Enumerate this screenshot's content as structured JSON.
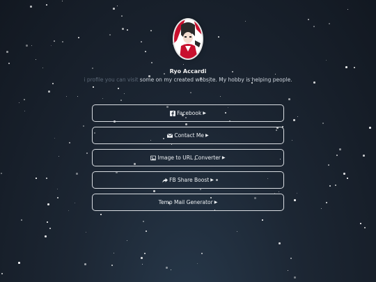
{
  "profile": {
    "name": "Ryo Accardi",
    "bio_faded": "i profile you can visit ",
    "bio_main": "some on my created website. My hobby is helping people."
  },
  "links": [
    {
      "label": "Facebook",
      "icon": "facebook-icon"
    },
    {
      "label": "Contact Me",
      "icon": "envelope-icon"
    },
    {
      "label": "Image to URL Converter",
      "icon": "image-icon"
    },
    {
      "label": "FB Share Boost",
      "icon": "share-icon"
    },
    {
      "label": "Temp Mail Generator",
      "icon": ""
    }
  ],
  "colors": {
    "background": "#1c2633",
    "button_border": "#d9dde2",
    "avatar_accent": "#c8102e"
  }
}
